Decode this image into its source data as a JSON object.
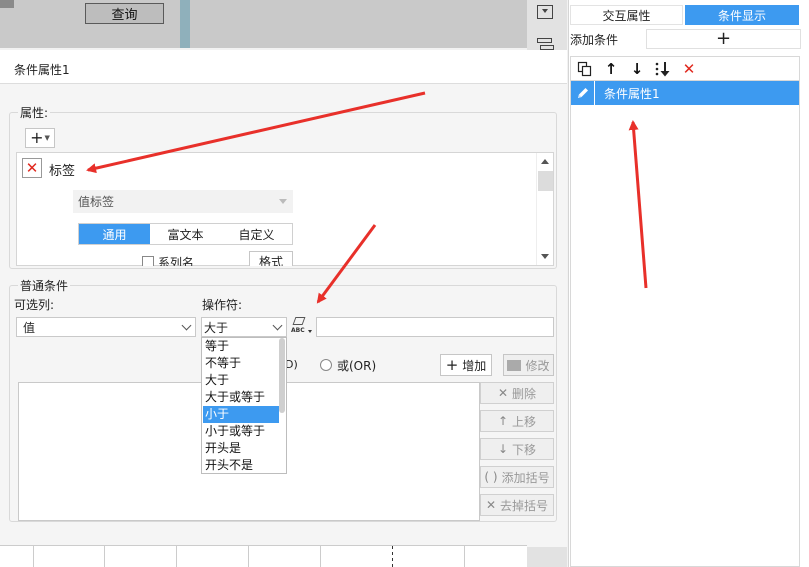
{
  "background": {
    "query_button": "查询"
  },
  "right_panel": {
    "tabs": [
      "交互属性",
      "条件显示"
    ],
    "active_tab": "条件显示",
    "add_condition_label": "添加条件",
    "add_condition_plus": "+",
    "toolbar_icons": [
      "copy-icon",
      "arrow-up-icon",
      "arrow-down-icon",
      "sort-down-icon",
      "delete-icon"
    ],
    "toolbar_glyphs": [
      "↑",
      "↓",
      "✕"
    ],
    "list_items": [
      {
        "label": "条件属性1",
        "selected": true
      }
    ]
  },
  "dialog": {
    "title": "条件属性1",
    "attributes": {
      "legend": "属性:",
      "add_glyph": "+",
      "tag_label": "标签",
      "value_tag_select": "值标签",
      "segments": [
        "通用",
        "富文本",
        "自定义"
      ],
      "active_segment": "通用",
      "series_name_label": "系列名",
      "format_button": "格式"
    },
    "normal_condition": {
      "legend": "普通条件",
      "column_label": "可选列:",
      "operator_label": "操作符:",
      "column_value": "值",
      "operator_value": "大于",
      "and_label": "D)",
      "or_label": "或(OR)",
      "add_button": "增加",
      "edit_button": "修改",
      "side_buttons": [
        "删除",
        "上移",
        "下移",
        "添加括号",
        "去掉括号"
      ],
      "side_glyphs": [
        "✕",
        "↑",
        "↓",
        "( )",
        "✕"
      ],
      "operator_options": [
        "等于",
        "不等于",
        "大于",
        "大于或等于",
        "小于",
        "小于或等于",
        "开头是",
        "开头不是"
      ],
      "highlighted_option": "小于"
    }
  },
  "colors": {
    "accent": "#3d9af0",
    "annotation_arrow": "#e8302a",
    "delete_red": "#e0281e"
  }
}
